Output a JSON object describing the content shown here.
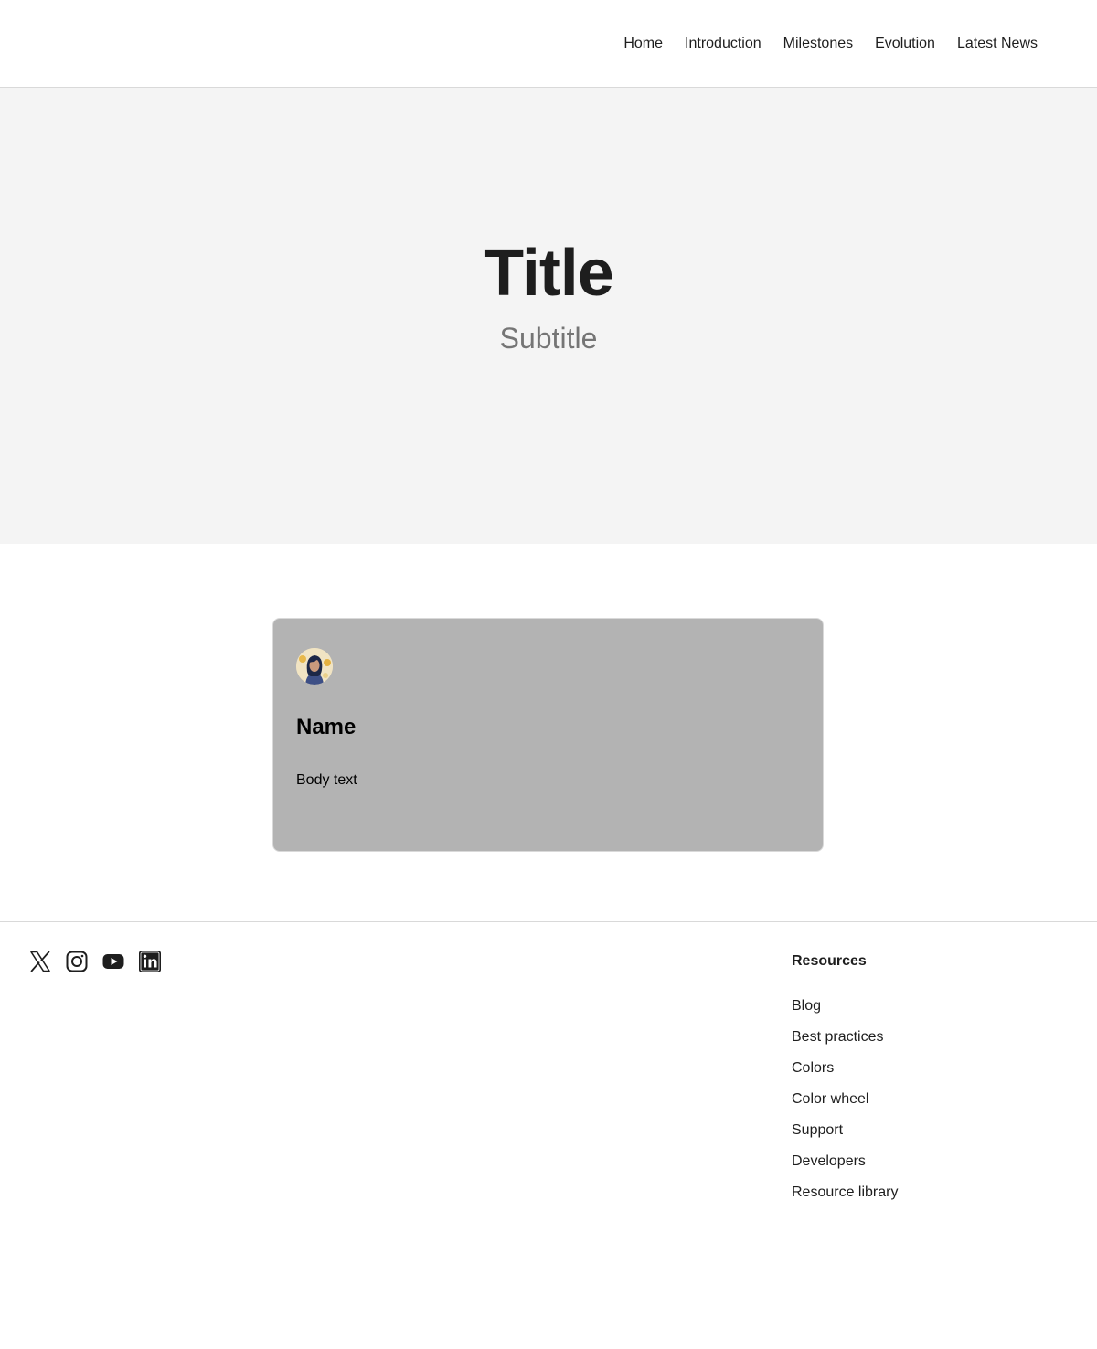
{
  "nav": {
    "items": [
      {
        "label": "Home"
      },
      {
        "label": "Introduction"
      },
      {
        "label": "Milestones"
      },
      {
        "label": "Evolution"
      },
      {
        "label": "Latest News"
      }
    ]
  },
  "hero": {
    "title": "Title",
    "subtitle": "Subtitle"
  },
  "card": {
    "name": "Name",
    "body": "Body text"
  },
  "footer": {
    "socials": [
      "x-icon",
      "instagram-icon",
      "youtube-icon",
      "linkedin-icon"
    ],
    "resources": {
      "title": "Resources",
      "links": [
        "Blog",
        "Best practices",
        "Colors",
        "Color wheel",
        "Support",
        "Developers",
        "Resource library"
      ]
    }
  },
  "colors": {
    "text": "#1e1e1e",
    "subtitle": "#757575",
    "hero_bg": "#f4f4f4",
    "card_bg": "#b3b3b3",
    "border": "#d9d9d9"
  }
}
